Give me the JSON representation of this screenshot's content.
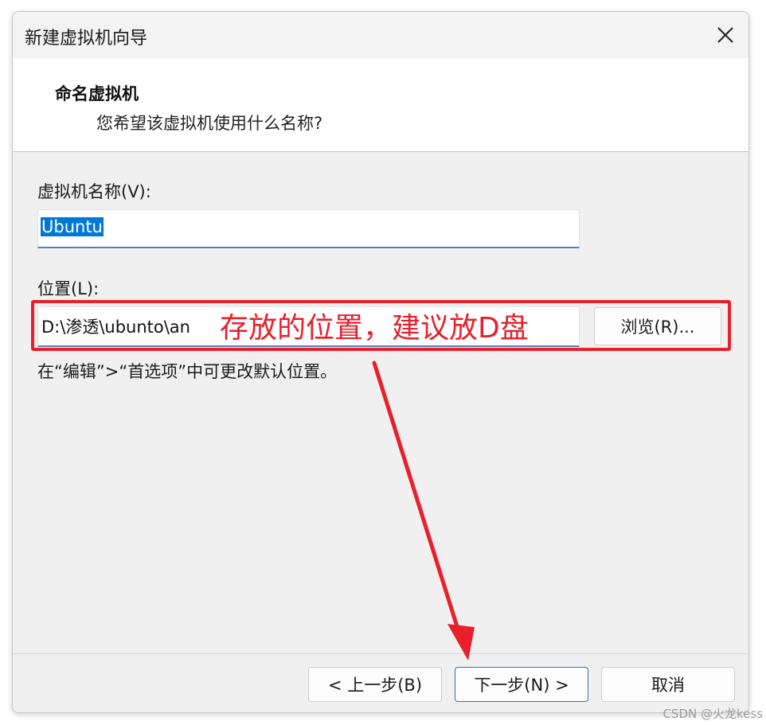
{
  "window": {
    "title": "新建虚拟机向导"
  },
  "header": {
    "title": "命名虚拟机",
    "subtitle": "您希望该虚拟机使用什么名称?"
  },
  "form": {
    "vm_name_label": "虚拟机名称(V):",
    "vm_name_value": "Ubuntu",
    "location_label": "位置(L):",
    "location_value": "D:\\渗透\\ubunto\\an",
    "browse_label": "浏览(R)...",
    "hint": "在“编辑”>“首选项”中可更改默认位置。"
  },
  "footer": {
    "back_label": "< 上一步(B)",
    "next_label": "下一步(N) >",
    "cancel_label": "取消"
  },
  "annotation": {
    "text": "存放的位置，建议放D盘",
    "color": "#e8202c"
  },
  "watermark": "CSDN @火龙kess",
  "icons": {
    "close": "close-icon"
  },
  "colors": {
    "selection": "#0078d7",
    "input_underline": "#5a7fb5",
    "primary_border": "#3b6fb3"
  }
}
